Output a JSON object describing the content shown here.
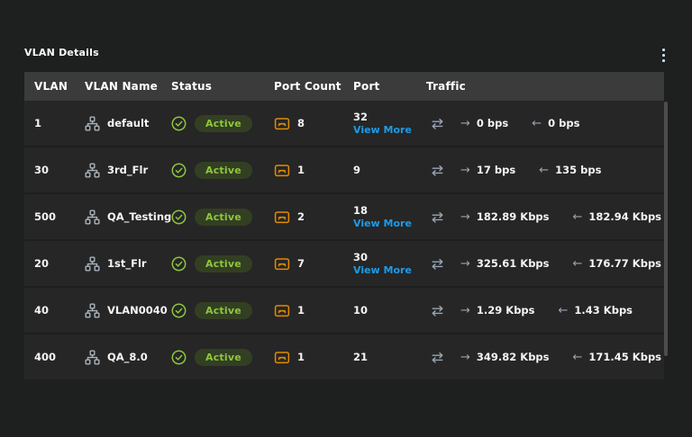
{
  "panel": {
    "title": "VLAN Details",
    "menu_icon": "kebab-vertical"
  },
  "colors": {
    "page_bg": "#1e1f1f",
    "header_bg": "#3b3b3b",
    "row_bg": "#262626",
    "accent_green": "#8dc63f",
    "badge_bg": "#333f22",
    "accent_orange": "#e18b00",
    "link_blue": "#1e9be9",
    "arrow_gray": "#97a5b4",
    "icon_gray": "#a9b4bd"
  },
  "icons": {
    "tx_arrow": "→",
    "rx_arrow": "←"
  },
  "table": {
    "columns": [
      "VLAN",
      "VLAN Name",
      "Status",
      "Port Count",
      "Port",
      "Traffic"
    ],
    "rows": [
      {
        "vlan": "1",
        "name": "default",
        "status": "Active",
        "port_count": "8",
        "port": "32",
        "view_more": "View More",
        "tx": "0 bps",
        "rx": "0 bps"
      },
      {
        "vlan": "30",
        "name": "3rd_Flr",
        "status": "Active",
        "port_count": "1",
        "port": "9",
        "view_more": "",
        "tx": "17 bps",
        "rx": "135 bps"
      },
      {
        "vlan": "500",
        "name": "QA_Testing",
        "status": "Active",
        "port_count": "2",
        "port": "18",
        "view_more": "View More",
        "tx": "182.89 Kbps",
        "rx": "182.94 Kbps"
      },
      {
        "vlan": "20",
        "name": "1st_Flr",
        "status": "Active",
        "port_count": "7",
        "port": "30",
        "view_more": "View More",
        "tx": "325.61 Kbps",
        "rx": "176.77 Kbps"
      },
      {
        "vlan": "40",
        "name": "VLAN0040",
        "status": "Active",
        "port_count": "1",
        "port": "10",
        "view_more": "",
        "tx": "1.29 Kbps",
        "rx": "1.43 Kbps"
      },
      {
        "vlan": "400",
        "name": "QA_8.0",
        "status": "Active",
        "port_count": "1",
        "port": "21",
        "view_more": "",
        "tx": "349.82 Kbps",
        "rx": "171.45 Kbps"
      }
    ]
  }
}
